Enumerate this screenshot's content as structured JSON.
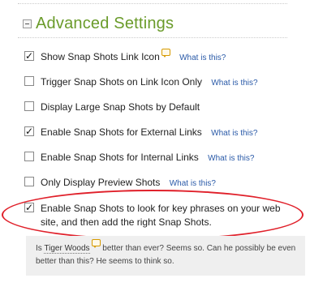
{
  "section": {
    "title": "Advanced Settings",
    "collapse_icon": "minus-box-icon"
  },
  "options": [
    {
      "label": "Show Snap Shots Link Icon",
      "checked": true,
      "help": "What is this?",
      "has_snap_icon": true
    },
    {
      "label": "Trigger Snap Shots on Link Icon Only",
      "checked": false,
      "help": "What is this?"
    },
    {
      "label": "Display Large Snap Shots by Default",
      "checked": false,
      "help": ""
    },
    {
      "label": "Enable Snap Shots for External Links",
      "checked": true,
      "help": "What is this?"
    },
    {
      "label": "Enable Snap Shots for Internal Links",
      "checked": false,
      "help": "What is this?"
    },
    {
      "label": "Only Display Preview Shots",
      "checked": false,
      "help": "What is this?"
    },
    {
      "label": "Enable Snap Shots to look for key phrases on your web site, and then add the right Snap Shots.",
      "checked": true,
      "help": ""
    }
  ],
  "example": {
    "prefix": "Is ",
    "link_text": "Tiger Woods",
    "suffix": " better than ever? Seems so. Can he possibly be even better than this? He seems to think so."
  },
  "colors": {
    "title": "#6a9b2a",
    "help_link": "#2a5aa8",
    "highlight_ring": "#e0202a",
    "example_bg": "#efefef"
  }
}
